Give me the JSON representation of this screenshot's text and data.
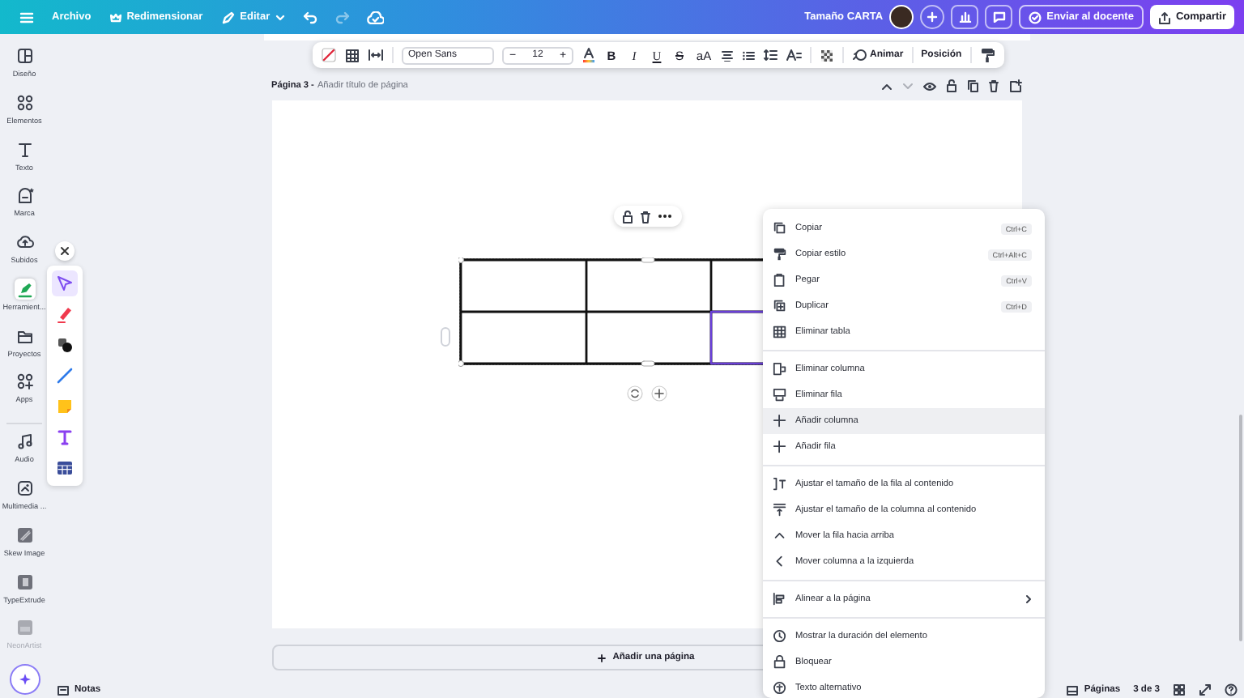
{
  "top_bar": {
    "file_menu": "Archivo",
    "resize": "Redimensionar",
    "edit": "Editar",
    "history": [
      {
        "disabled": false
      },
      {
        "disabled": true
      }
    ],
    "document_title": "Tamaño CARTA",
    "send_button": "Enviar al docente",
    "share_button": "Compartir"
  },
  "sidebar": {
    "items": [
      {
        "label": "Diseño",
        "selected": false,
        "disabled": false
      },
      {
        "label": "Elementos",
        "selected": false,
        "disabled": false
      },
      {
        "label": "Texto",
        "selected": false,
        "disabled": false
      },
      {
        "label": "Marca",
        "selected": false,
        "disabled": false
      },
      {
        "label": "Subidos",
        "selected": false,
        "disabled": false
      },
      {
        "label": "Herramient...",
        "selected": true,
        "disabled": false
      },
      {
        "label": "Proyectos",
        "selected": false,
        "disabled": false
      },
      {
        "label": "Apps",
        "selected": false,
        "disabled": false
      },
      {
        "label": "Audio",
        "selected": false,
        "disabled": false
      },
      {
        "label": "Multimedia ...",
        "selected": false,
        "disabled": false
      },
      {
        "label": "Skew Image",
        "selected": false,
        "disabled": false
      },
      {
        "label": "TypeExtrude",
        "selected": false,
        "disabled": false
      },
      {
        "label": "NeonArtist",
        "selected": false,
        "disabled": true
      }
    ]
  },
  "draw_tools": {
    "items": [
      {
        "selected": true
      },
      {
        "selected": false
      },
      {
        "selected": false
      },
      {
        "selected": false
      },
      {
        "selected": false
      },
      {
        "selected": false
      },
      {
        "selected": false
      }
    ]
  },
  "text_toolbar": {
    "font": "Open Sans",
    "minus": "−",
    "size": "12",
    "plus": "+",
    "format_buttons": [
      "B",
      "I",
      "U",
      "S",
      "aA"
    ],
    "animate": "Animar",
    "position": "Posición"
  },
  "page": {
    "label": "Página 3 -",
    "title_placeholder": "Añadir título de página",
    "nav": [
      {
        "disabled": false
      },
      {
        "disabled": true
      }
    ]
  },
  "add_page_button": "Añadir una página",
  "context_menu": {
    "groups": [
      {
        "items": [
          {
            "label": "Copiar",
            "shortcut": "Ctrl+C",
            "selected": false,
            "submenu": false
          },
          {
            "label": "Copiar estilo",
            "shortcut": "Ctrl+Alt+C",
            "selected": false,
            "submenu": false
          },
          {
            "label": "Pegar",
            "shortcut": "Ctrl+V",
            "selected": false,
            "submenu": false
          },
          {
            "label": "Duplicar",
            "shortcut": "Ctrl+D",
            "selected": false,
            "submenu": false
          },
          {
            "label": "Eliminar tabla",
            "selected": false,
            "submenu": false
          }
        ]
      },
      {
        "items": [
          {
            "label": "Eliminar columna",
            "selected": false,
            "submenu": false
          },
          {
            "label": "Eliminar fila",
            "selected": false,
            "submenu": false
          },
          {
            "label": "Añadir columna",
            "selected": true,
            "submenu": false
          },
          {
            "label": "Añadir fila",
            "selected": false,
            "submenu": false
          }
        ]
      },
      {
        "items": [
          {
            "label": "Ajustar el tamaño de la fila al contenido",
            "selected": false,
            "submenu": false
          },
          {
            "label": "Ajustar el tamaño de la columna al contenido",
            "selected": false,
            "submenu": false
          },
          {
            "label": "Mover la fila hacia arriba",
            "selected": false,
            "submenu": false
          },
          {
            "label": "Mover columna a la izquierda",
            "selected": false,
            "submenu": false
          }
        ]
      },
      {
        "items": [
          {
            "label": "Alinear a la página",
            "selected": false,
            "submenu": true
          }
        ]
      },
      {
        "items": [
          {
            "label": "Mostrar la duración del elemento",
            "selected": false,
            "submenu": false
          },
          {
            "label": "Bloquear",
            "selected": false,
            "submenu": false
          },
          {
            "label": "Texto alternativo",
            "selected": false,
            "submenu": false
          }
        ]
      }
    ]
  },
  "bottom_bar": {
    "notes": "Notas",
    "pages": "Páginas",
    "page_count": "3 de 3"
  }
}
